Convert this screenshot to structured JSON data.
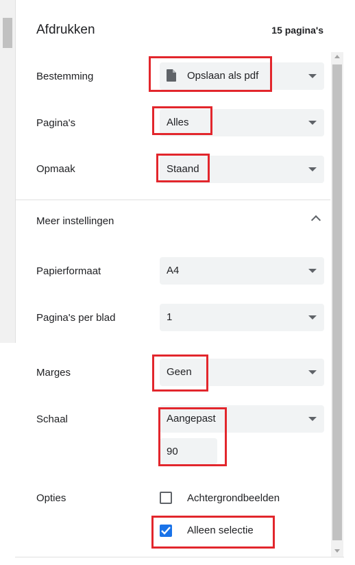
{
  "header": {
    "title": "Afdrukken",
    "pages": "15 pagina's"
  },
  "destination": {
    "label": "Bestemming",
    "value": "Opslaan als pdf",
    "icon": "file-icon"
  },
  "pages": {
    "label": "Pagina's",
    "value": "Alles"
  },
  "layout": {
    "label": "Opmaak",
    "value": "Staand"
  },
  "more_settings": {
    "label": "Meer instellingen",
    "icon": "chevron-up-icon"
  },
  "paper_size": {
    "label": "Papierformaat",
    "value": "A4"
  },
  "pages_per_sheet": {
    "label": "Pagina's per blad",
    "value": "1"
  },
  "margins": {
    "label": "Marges",
    "value": "Geen"
  },
  "scale": {
    "label": "Schaal",
    "value": "Aangepast",
    "custom_value": "90"
  },
  "options": {
    "label": "Opties",
    "items": [
      {
        "label": "Achtergrondbeelden",
        "checked": false
      },
      {
        "label": "Alleen selectie",
        "checked": true
      }
    ]
  },
  "colors": {
    "accent": "#1a73e8",
    "annotation": "#e2262c",
    "field_bg": "#f1f3f4"
  }
}
